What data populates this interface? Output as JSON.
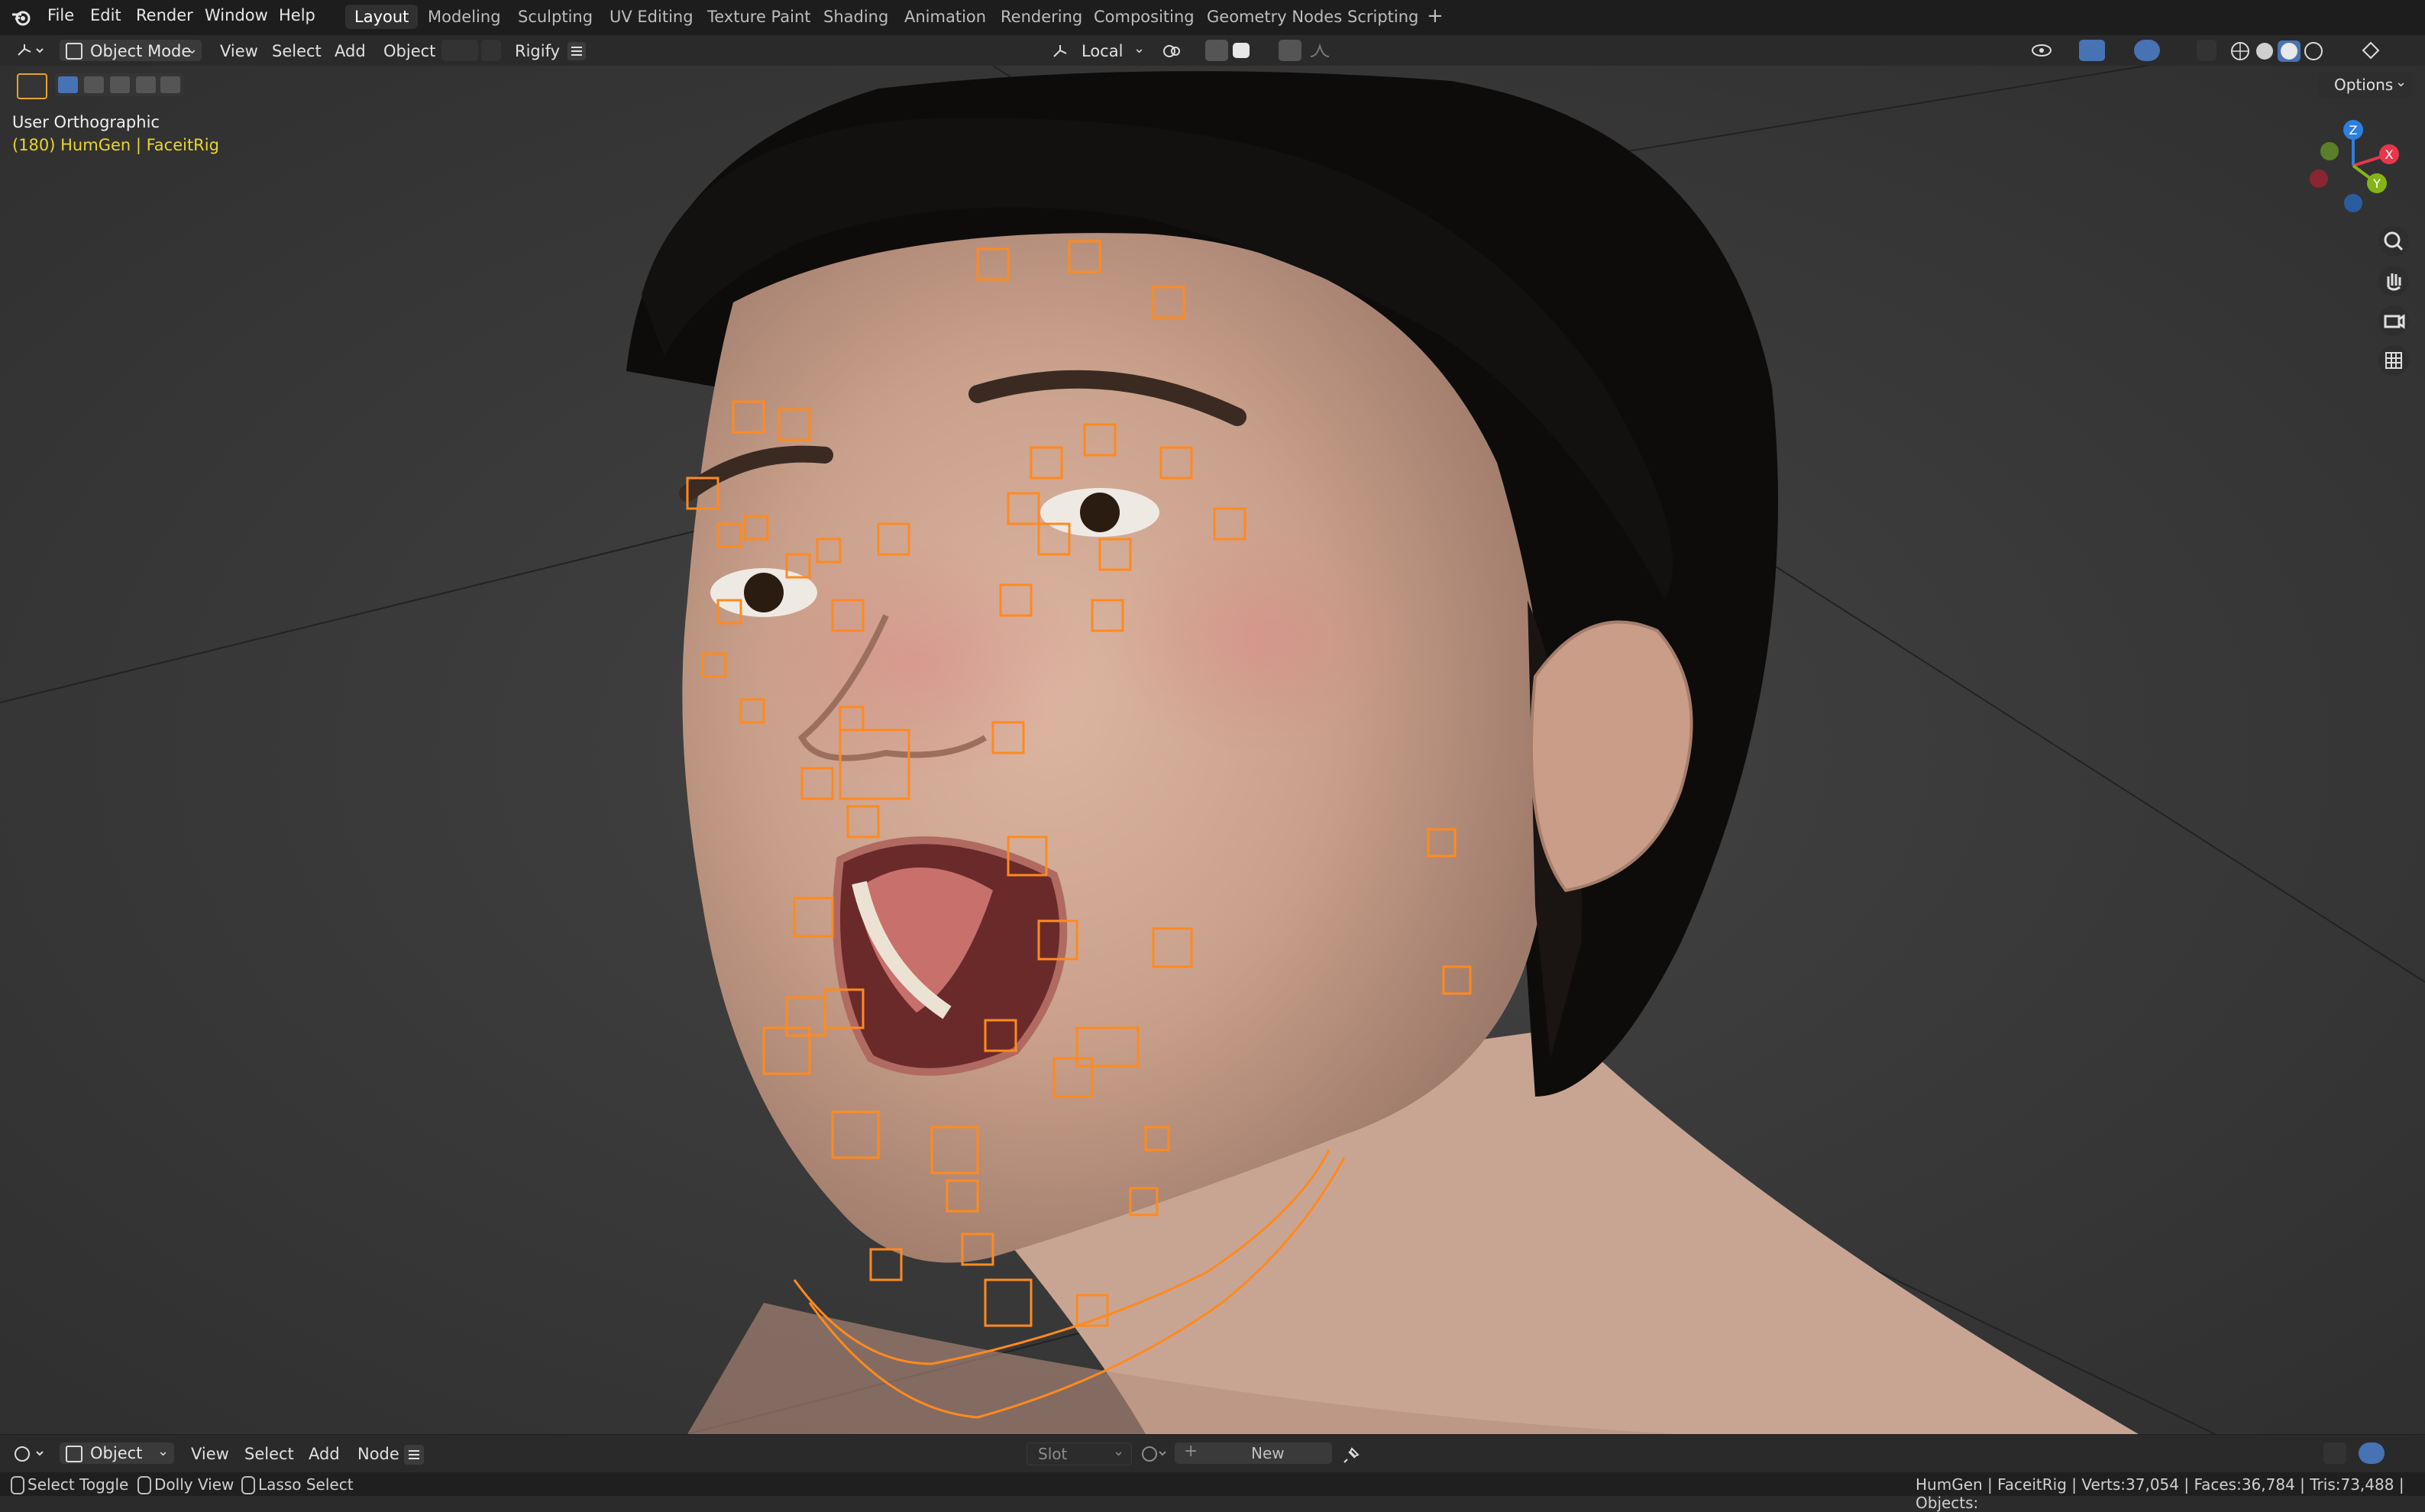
{
  "menu": {
    "file": "File",
    "edit": "Edit",
    "render": "Render",
    "window": "Window",
    "help": "Help"
  },
  "workspaces": [
    "Layout",
    "Modeling",
    "Sculpting",
    "UV Editing",
    "Texture Paint",
    "Shading",
    "Animation",
    "Rendering",
    "Compositing",
    "Geometry Nodes",
    "Scripting"
  ],
  "header": {
    "mode": "Object Mode",
    "view": "View",
    "select": "Select",
    "add": "Add",
    "object": "Object",
    "rigify": "Rigify",
    "transform_orientation": "Local",
    "options": "Options"
  },
  "overlay": {
    "view_name": "User Orthographic",
    "object_info": "(180) HumGen | FaceitRig"
  },
  "gizmo": {
    "x": "X",
    "y": "Y",
    "z": "Z"
  },
  "node_header": {
    "editor_type": "Object",
    "view": "View",
    "select": "Select",
    "add": "Add",
    "node": "Node",
    "slot": "Slot",
    "new": "New"
  },
  "status": {
    "select_toggle": "Select Toggle",
    "dolly_view": "Dolly View",
    "lasso_select": "Lasso Select",
    "stats": "HumGen | FaceitRig | Verts:37,054 | Faces:36,784 | Tris:73,488 | Objects:"
  },
  "colors": {
    "accent": "#4772b3",
    "rig_orange": "#ff8a1f",
    "info_yellow": "#e8d62e",
    "axis_x": "#e8374b",
    "axis_y": "#86b318",
    "axis_z": "#2d7fe0"
  }
}
